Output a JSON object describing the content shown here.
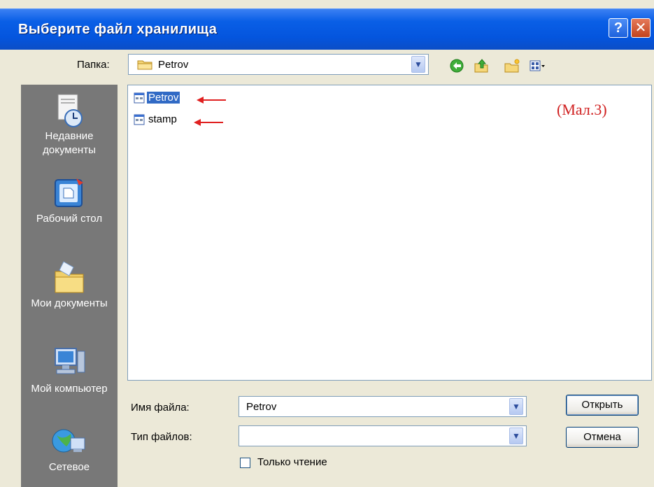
{
  "window": {
    "title": "Выберите файл хранилища",
    "help_label": "?",
    "close_label": "✕"
  },
  "toolbar": {
    "lookin_label": "Папка:",
    "lookin_value": "Petrov",
    "icons": [
      "back-icon",
      "up-folder-icon",
      "new-folder-icon",
      "view-menu-icon"
    ]
  },
  "places": [
    {
      "label": "Недавние документы",
      "icon": "recent-documents-icon"
    },
    {
      "label": "Рабочий стол",
      "icon": "desktop-icon"
    },
    {
      "label": "Мои документы",
      "icon": "my-documents-icon"
    },
    {
      "label": "Мой компьютер",
      "icon": "my-computer-icon"
    },
    {
      "label": "Сетевое",
      "icon": "network-icon"
    }
  ],
  "files": [
    {
      "name": "Petrov",
      "selected": true
    },
    {
      "name": "stamp",
      "selected": false
    }
  ],
  "annotation": "(Мал.3)",
  "form": {
    "filename_label": "Имя файла:",
    "filename_value": "Petrov",
    "filetype_label": "Тип файлов:",
    "filetype_value": "",
    "readonly_label": "Только чтение",
    "readonly_checked": false
  },
  "buttons": {
    "open": "Открыть",
    "cancel": "Отмена"
  },
  "colors": {
    "titlebar": "#0455de",
    "selection": "#316ac5",
    "annotation": "#d02020",
    "places_bg": "#787878"
  }
}
